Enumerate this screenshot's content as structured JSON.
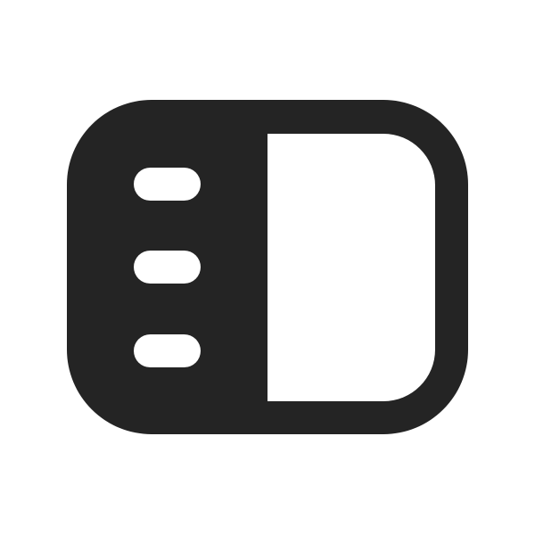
{
  "icon": {
    "name": "sidebar-panel-icon",
    "colors": {
      "foreground": "#242424",
      "background": "#ffffff"
    }
  }
}
